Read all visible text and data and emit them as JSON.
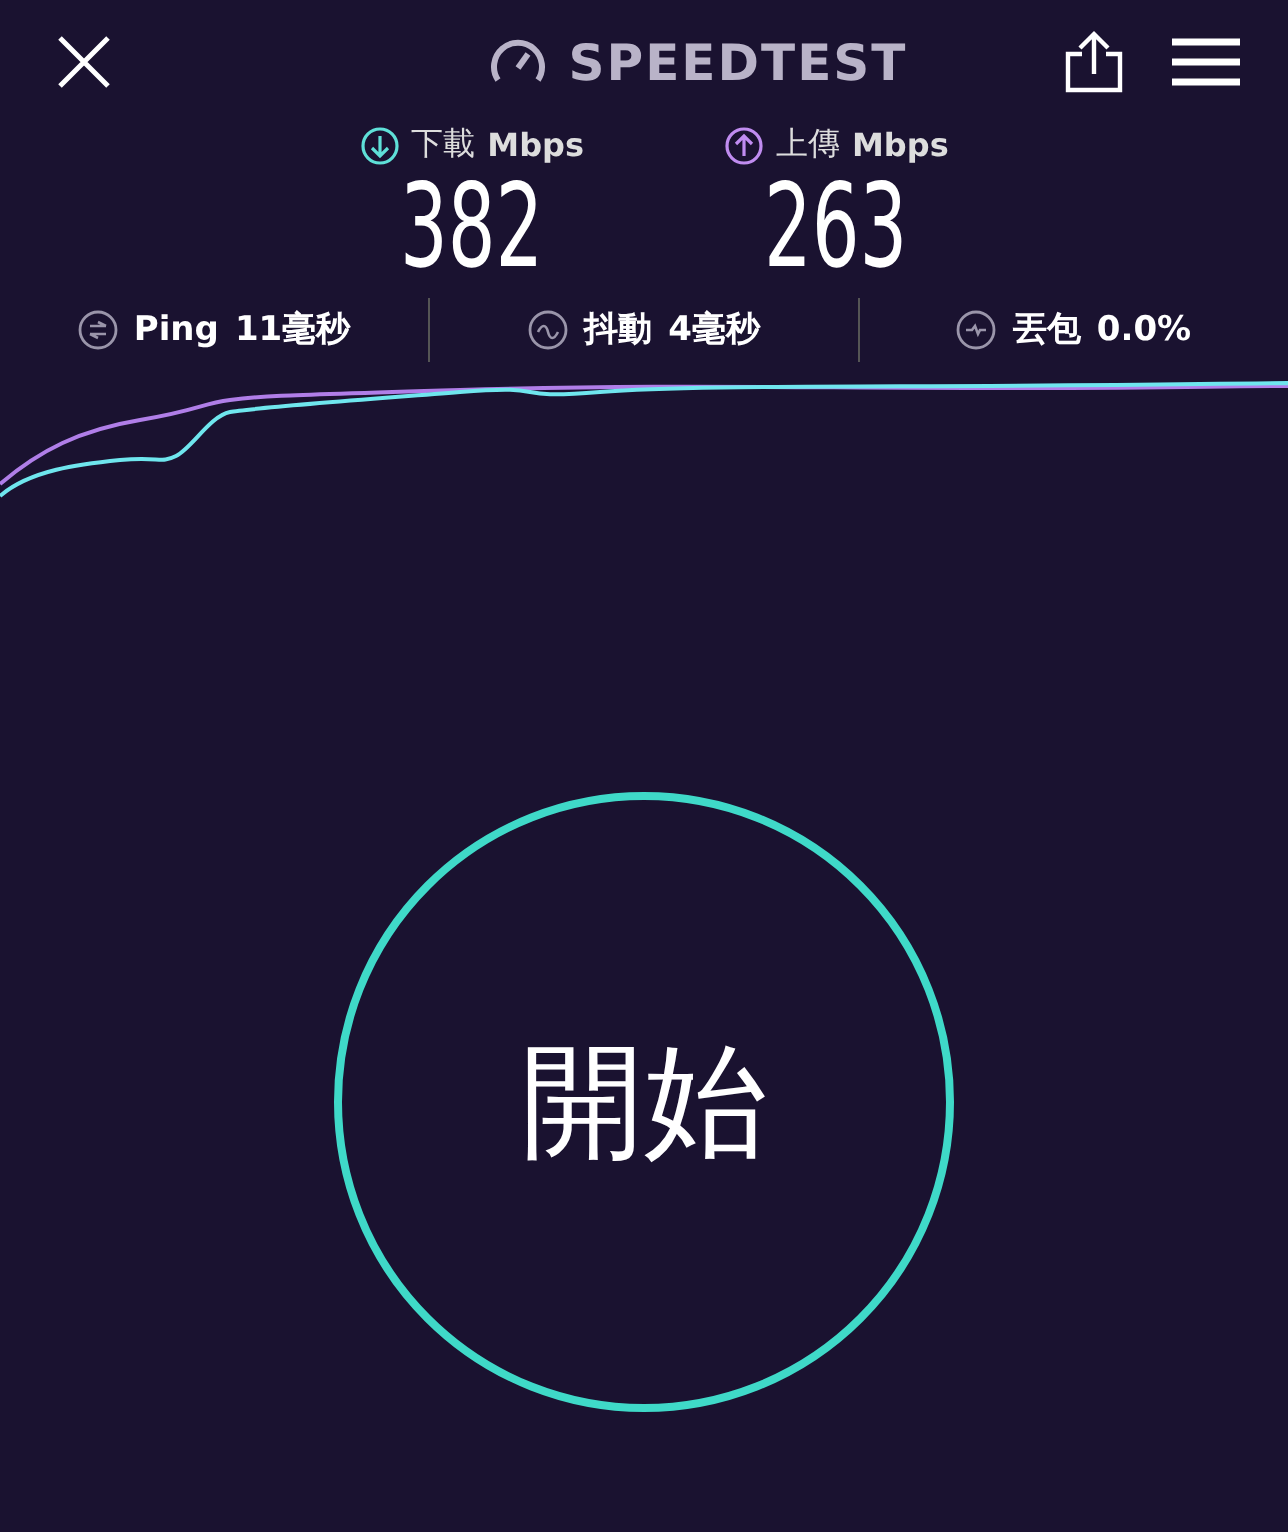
{
  "header": {
    "title": "SPEEDTEST"
  },
  "speeds": [
    {
      "kind": "download",
      "label": "下載",
      "unit": "Mbps",
      "value": "382"
    },
    {
      "kind": "upload",
      "label": "上傳",
      "unit": "Mbps",
      "value": "263"
    }
  ],
  "stats": [
    {
      "kind": "ping",
      "label": "Ping",
      "value": "11毫秒"
    },
    {
      "kind": "jitter",
      "label": "抖動",
      "value": "4毫秒"
    },
    {
      "kind": "loss",
      "label": "丟包",
      "value": "0.0%"
    }
  ],
  "start_button": {
    "label": "開始"
  }
}
